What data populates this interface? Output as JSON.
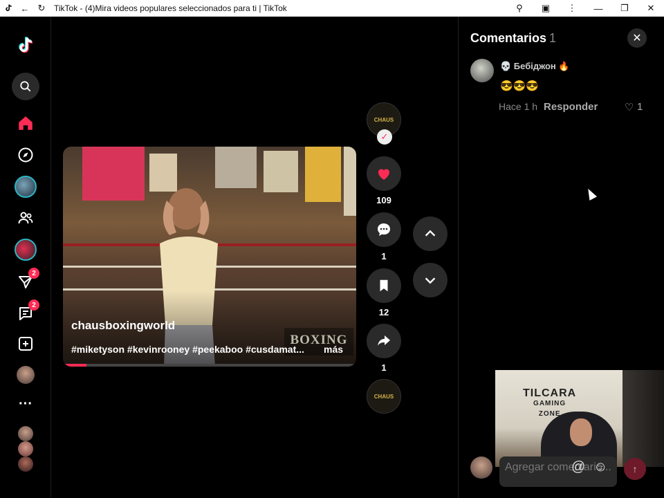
{
  "window": {
    "title": "TikTok - (4)Mira videos populares seleccionados para ti | TikTok",
    "back_icon": "arrow-left-icon",
    "reload_icon": "reload-icon",
    "zoom_icon": "zoom-icon",
    "extensions_icon": "puzzle-icon",
    "menu_icon": "kebab-menu-icon"
  },
  "sidebar": {
    "messages_badge": "2",
    "inbox_badge": "2",
    "more_label": "···"
  },
  "video": {
    "author": "chausboxingworld",
    "hashtags": "#miketyson #kevinrooney #peekaboo #cusdamat...",
    "more_label": "más",
    "watermark": "BOXING",
    "progress": 0.08
  },
  "actions": {
    "likes": "109",
    "comments": "1",
    "saves": "12",
    "shares": "1"
  },
  "comments_panel": {
    "title": "Comentarios",
    "count": "1",
    "items": [
      {
        "username": "💀 Бебіджон 🔥",
        "text": "😎😎😎",
        "time": "Hace 1 h",
        "reply_label": "Responder",
        "likes": "1"
      }
    ],
    "input_placeholder": "Agregar comentario..."
  },
  "webcam": {
    "sign_line1": "TILCARA",
    "sign_line2": "GAMING",
    "sign_line3": "ZONE"
  },
  "colors": {
    "accent": "#fe2c55",
    "background": "#000000",
    "button_bg": "#2a2a2a"
  }
}
